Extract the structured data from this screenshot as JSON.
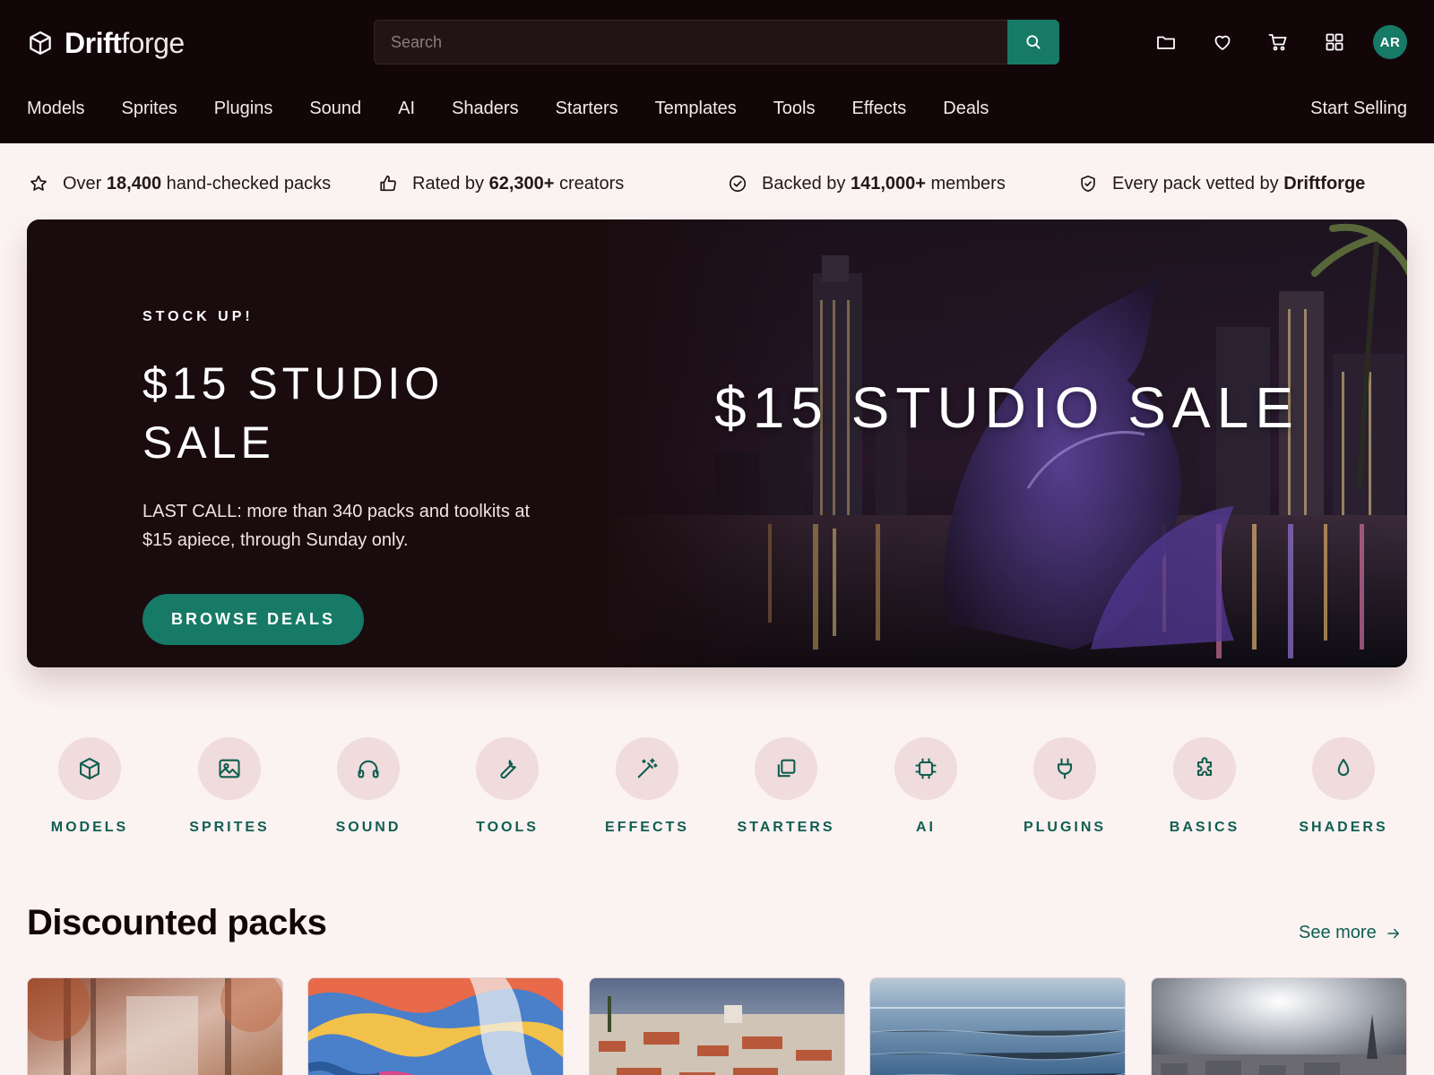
{
  "header": {
    "logo_bold": "Drift",
    "logo_light": "forge",
    "search_placeholder": "Search",
    "icons": [
      "folder-icon",
      "heart-icon",
      "cart-icon",
      "grid-icon"
    ],
    "avatar_initials": "AR"
  },
  "nav": {
    "items": [
      "Models",
      "Sprites",
      "Plugins",
      "Sound",
      "AI",
      "Shaders",
      "Starters",
      "Templates",
      "Tools",
      "Effects",
      "Deals"
    ],
    "start_selling": "Start Selling"
  },
  "trust": [
    {
      "icon": "star-icon",
      "pre": "Over ",
      "bold": "18,400",
      "post": " hand-checked packs"
    },
    {
      "icon": "thumbs-up-icon",
      "pre": "Rated by ",
      "bold": "62,300+",
      "post": " creators"
    },
    {
      "icon": "check-circle-icon",
      "pre": "Backed by ",
      "bold": "141,000+",
      "post": " members"
    },
    {
      "icon": "shield-check-icon",
      "pre": "Every pack vetted by ",
      "bold": "Driftforge",
      "post": ""
    }
  ],
  "hero": {
    "eyebrow": "STOCK UP!",
    "title": "$15 STUDIO SALE",
    "body": "LAST CALL: more than 340 packs and toolkits at $15 apiece, through Sunday only.",
    "button": "BROWSE DEALS",
    "image_title": "$15 STUDIO SALE"
  },
  "categories": [
    {
      "label": "MODELS",
      "icon": "cube-icon"
    },
    {
      "label": "SPRITES",
      "icon": "image-icon"
    },
    {
      "label": "SOUND",
      "icon": "headphones-icon"
    },
    {
      "label": "TOOLS",
      "icon": "wrench-icon"
    },
    {
      "label": "EFFECTS",
      "icon": "magic-wand-icon"
    },
    {
      "label": "STARTERS",
      "icon": "copy-icon"
    },
    {
      "label": "AI",
      "icon": "chip-icon"
    },
    {
      "label": "PLUGINS",
      "icon": "plug-icon"
    },
    {
      "label": "BASICS",
      "icon": "puzzle-icon"
    },
    {
      "label": "SHADERS",
      "icon": "droplet-icon"
    }
  ],
  "discounted": {
    "title": "Discounted packs",
    "see_more": "See more"
  },
  "colors": {
    "accent": "#167a66",
    "header_bg": "#130609",
    "page_bg": "#fbf2f2",
    "category_circle": "#f0dbdd"
  }
}
